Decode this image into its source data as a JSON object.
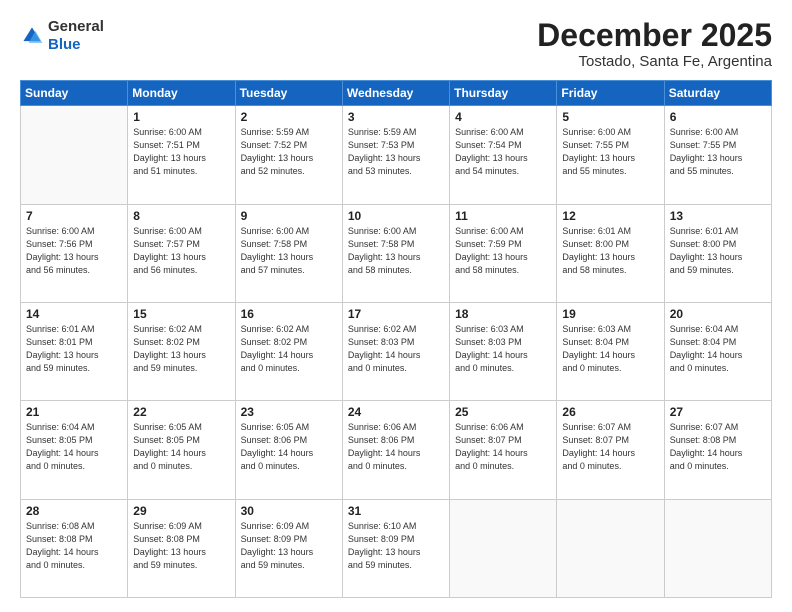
{
  "logo": {
    "general": "General",
    "blue": "Blue"
  },
  "header": {
    "month": "December 2025",
    "location": "Tostado, Santa Fe, Argentina"
  },
  "weekdays": [
    "Sunday",
    "Monday",
    "Tuesday",
    "Wednesday",
    "Thursday",
    "Friday",
    "Saturday"
  ],
  "weeks": [
    [
      {
        "day": "",
        "info": ""
      },
      {
        "day": "1",
        "info": "Sunrise: 6:00 AM\nSunset: 7:51 PM\nDaylight: 13 hours\nand 51 minutes."
      },
      {
        "day": "2",
        "info": "Sunrise: 5:59 AM\nSunset: 7:52 PM\nDaylight: 13 hours\nand 52 minutes."
      },
      {
        "day": "3",
        "info": "Sunrise: 5:59 AM\nSunset: 7:53 PM\nDaylight: 13 hours\nand 53 minutes."
      },
      {
        "day": "4",
        "info": "Sunrise: 6:00 AM\nSunset: 7:54 PM\nDaylight: 13 hours\nand 54 minutes."
      },
      {
        "day": "5",
        "info": "Sunrise: 6:00 AM\nSunset: 7:55 PM\nDaylight: 13 hours\nand 55 minutes."
      },
      {
        "day": "6",
        "info": "Sunrise: 6:00 AM\nSunset: 7:55 PM\nDaylight: 13 hours\nand 55 minutes."
      }
    ],
    [
      {
        "day": "7",
        "info": "Sunrise: 6:00 AM\nSunset: 7:56 PM\nDaylight: 13 hours\nand 56 minutes."
      },
      {
        "day": "8",
        "info": "Sunrise: 6:00 AM\nSunset: 7:57 PM\nDaylight: 13 hours\nand 56 minutes."
      },
      {
        "day": "9",
        "info": "Sunrise: 6:00 AM\nSunset: 7:58 PM\nDaylight: 13 hours\nand 57 minutes."
      },
      {
        "day": "10",
        "info": "Sunrise: 6:00 AM\nSunset: 7:58 PM\nDaylight: 13 hours\nand 58 minutes."
      },
      {
        "day": "11",
        "info": "Sunrise: 6:00 AM\nSunset: 7:59 PM\nDaylight: 13 hours\nand 58 minutes."
      },
      {
        "day": "12",
        "info": "Sunrise: 6:01 AM\nSunset: 8:00 PM\nDaylight: 13 hours\nand 58 minutes."
      },
      {
        "day": "13",
        "info": "Sunrise: 6:01 AM\nSunset: 8:00 PM\nDaylight: 13 hours\nand 59 minutes."
      }
    ],
    [
      {
        "day": "14",
        "info": "Sunrise: 6:01 AM\nSunset: 8:01 PM\nDaylight: 13 hours\nand 59 minutes."
      },
      {
        "day": "15",
        "info": "Sunrise: 6:02 AM\nSunset: 8:02 PM\nDaylight: 13 hours\nand 59 minutes."
      },
      {
        "day": "16",
        "info": "Sunrise: 6:02 AM\nSunset: 8:02 PM\nDaylight: 14 hours\nand 0 minutes."
      },
      {
        "day": "17",
        "info": "Sunrise: 6:02 AM\nSunset: 8:03 PM\nDaylight: 14 hours\nand 0 minutes."
      },
      {
        "day": "18",
        "info": "Sunrise: 6:03 AM\nSunset: 8:03 PM\nDaylight: 14 hours\nand 0 minutes."
      },
      {
        "day": "19",
        "info": "Sunrise: 6:03 AM\nSunset: 8:04 PM\nDaylight: 14 hours\nand 0 minutes."
      },
      {
        "day": "20",
        "info": "Sunrise: 6:04 AM\nSunset: 8:04 PM\nDaylight: 14 hours\nand 0 minutes."
      }
    ],
    [
      {
        "day": "21",
        "info": "Sunrise: 6:04 AM\nSunset: 8:05 PM\nDaylight: 14 hours\nand 0 minutes."
      },
      {
        "day": "22",
        "info": "Sunrise: 6:05 AM\nSunset: 8:05 PM\nDaylight: 14 hours\nand 0 minutes."
      },
      {
        "day": "23",
        "info": "Sunrise: 6:05 AM\nSunset: 8:06 PM\nDaylight: 14 hours\nand 0 minutes."
      },
      {
        "day": "24",
        "info": "Sunrise: 6:06 AM\nSunset: 8:06 PM\nDaylight: 14 hours\nand 0 minutes."
      },
      {
        "day": "25",
        "info": "Sunrise: 6:06 AM\nSunset: 8:07 PM\nDaylight: 14 hours\nand 0 minutes."
      },
      {
        "day": "26",
        "info": "Sunrise: 6:07 AM\nSunset: 8:07 PM\nDaylight: 14 hours\nand 0 minutes."
      },
      {
        "day": "27",
        "info": "Sunrise: 6:07 AM\nSunset: 8:08 PM\nDaylight: 14 hours\nand 0 minutes."
      }
    ],
    [
      {
        "day": "28",
        "info": "Sunrise: 6:08 AM\nSunset: 8:08 PM\nDaylight: 14 hours\nand 0 minutes."
      },
      {
        "day": "29",
        "info": "Sunrise: 6:09 AM\nSunset: 8:08 PM\nDaylight: 13 hours\nand 59 minutes."
      },
      {
        "day": "30",
        "info": "Sunrise: 6:09 AM\nSunset: 8:09 PM\nDaylight: 13 hours\nand 59 minutes."
      },
      {
        "day": "31",
        "info": "Sunrise: 6:10 AM\nSunset: 8:09 PM\nDaylight: 13 hours\nand 59 minutes."
      },
      {
        "day": "",
        "info": ""
      },
      {
        "day": "",
        "info": ""
      },
      {
        "day": "",
        "info": ""
      }
    ]
  ]
}
